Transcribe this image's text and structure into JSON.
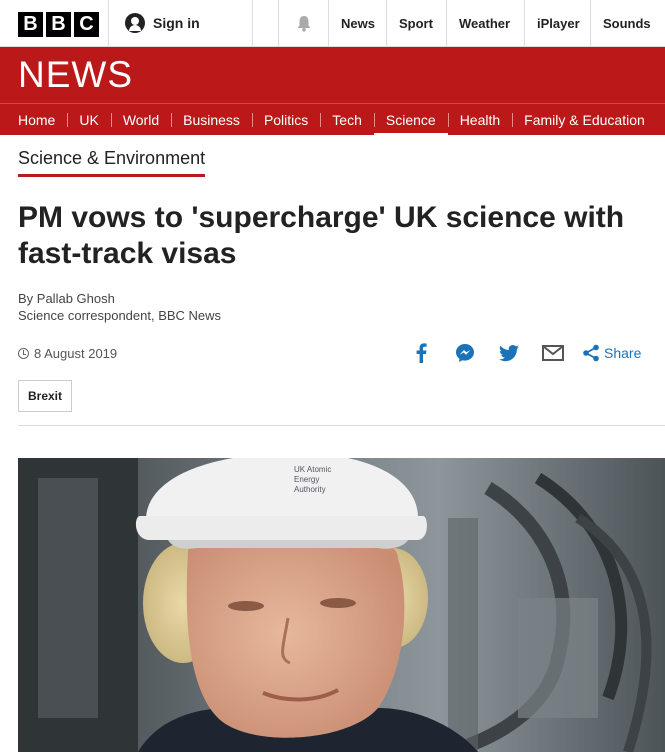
{
  "header": {
    "logo_letters": [
      "B",
      "B",
      "C"
    ],
    "signin_label": "Sign in",
    "nav": [
      "News",
      "Sport",
      "Weather",
      "iPlayer",
      "Sounds"
    ]
  },
  "banner": {
    "title": "NEWS",
    "color": "#bb1919"
  },
  "section_nav": {
    "items": [
      "Home",
      "UK",
      "World",
      "Business",
      "Politics",
      "Tech",
      "Science",
      "Health",
      "Family & Education"
    ],
    "active": "Science"
  },
  "article": {
    "section": "Science & Environment",
    "headline": "PM vows to 'supercharge' UK science with fast-track visas",
    "author": "By Pallab Ghosh",
    "author_role": "Science correspondent, BBC News",
    "date": "8 August 2019",
    "share_label": "Share",
    "tag": "Brexit",
    "image_helmet_text": [
      "UK Atomic",
      "Energy",
      "Authority"
    ]
  },
  "share_icons": [
    "facebook-icon",
    "messenger-icon",
    "twitter-icon",
    "email-icon",
    "share-icon"
  ],
  "colors": {
    "accent": "#bb1919",
    "link": "#1a73b8",
    "facebook": "#3b5998"
  }
}
